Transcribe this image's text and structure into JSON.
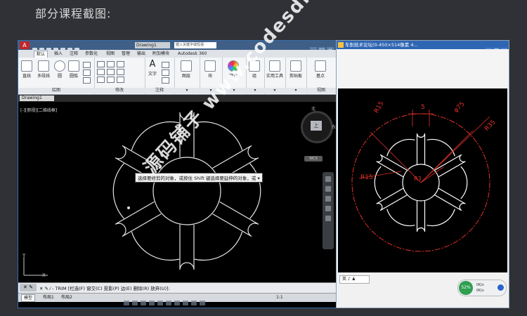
{
  "page": {
    "heading": "部分课程截图:"
  },
  "cad": {
    "doc_title": "Drawing1",
    "search_placeholder": "键入关键字或短语",
    "tabs": [
      "默认",
      "插入",
      "注释",
      "参数化",
      "视图",
      "管理",
      "输出",
      "附加模块",
      "Autodesk 360"
    ],
    "active_tab": "默认",
    "ribbon": {
      "draw_tools": [
        "直线",
        "多段线",
        "圆",
        "圆弧"
      ],
      "draw_group": "绘图",
      "modify_group": "修改",
      "annotation_text": "文字",
      "annotation_group": "注释",
      "layers": "图层",
      "block": "块",
      "properties": "特性",
      "group": "组",
      "utilities": "实用工具",
      "clipboard": "剪贴板",
      "base": "基点",
      "view_group": "视图"
    },
    "file_tab": "Drawing1",
    "viewport_label": "[-][俯视][二维线框]",
    "navcube_face": "上",
    "compass": {
      "north": "北",
      "east": "东"
    },
    "wcs_label": "WCS",
    "tooltip": "选择要修剪的对象，或按住 Shift 键选择要延伸的对象，或 ▾",
    "axis": {
      "y": "Y",
      "x": "X"
    },
    "command": "✕ ✎ ⁄ - TRIM [栏选(F) 窗交(C) 投影(P) 边(E) 删除(R) 放弃(U)]:",
    "status_tabs": [
      "模型",
      "布局1",
      "布局2"
    ],
    "status_zoom": "1:1"
  },
  "viewer": {
    "title": "车削技术论坛(0-450×514像素 4...",
    "lang": "英 ♪ ♟",
    "net_percent": "52%",
    "up_speed": "0K/s",
    "down_speed": "0K/s"
  },
  "drawing_labels": {
    "r15_a": "R15",
    "r5": "5",
    "phi75": "φ75",
    "r35": "R35",
    "r15_b": "R15",
    "r3": "R3"
  },
  "watermark": "源码铺子 www.codesdn.cn",
  "colors": {
    "accent_red": "#c1272d",
    "title_blue": "#2f66b3",
    "dim_red": "#e0312b",
    "cad_bg": "#000000"
  }
}
